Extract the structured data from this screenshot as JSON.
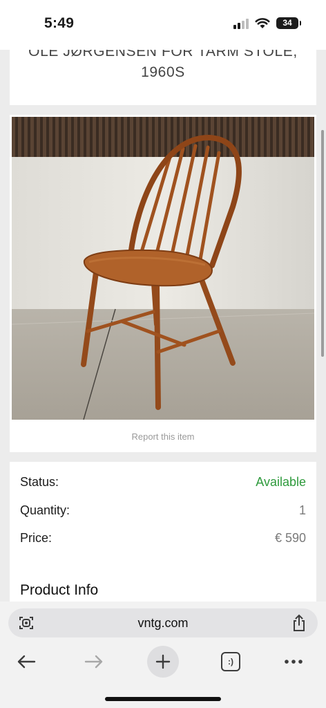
{
  "status_bar": {
    "time": "5:49",
    "battery": "34"
  },
  "listing": {
    "title_line1": "OLE JØRGENSEN FOR TARM STOLE,",
    "title_line2": "1960S",
    "photo_alt": "Wooden spindle-back chair",
    "report_link": "Report this item",
    "status_label": "Status:",
    "status_value": "Available",
    "quantity_label": "Quantity:",
    "quantity_value": "1",
    "price_label": "Price:",
    "price_value": "€ 590",
    "product_info_heading": "Product Info"
  },
  "browser": {
    "url": "vntg.com",
    "tabs_label": ":)",
    "icons": [
      "reader-icon",
      "share-icon",
      "back-arrow-icon",
      "forward-arrow-icon",
      "plus-icon",
      "tabs-icon",
      "more-icon"
    ]
  },
  "colors": {
    "available": "#2e9a3c",
    "page_background": "#ececec",
    "chair_wood": "#a0521f"
  }
}
